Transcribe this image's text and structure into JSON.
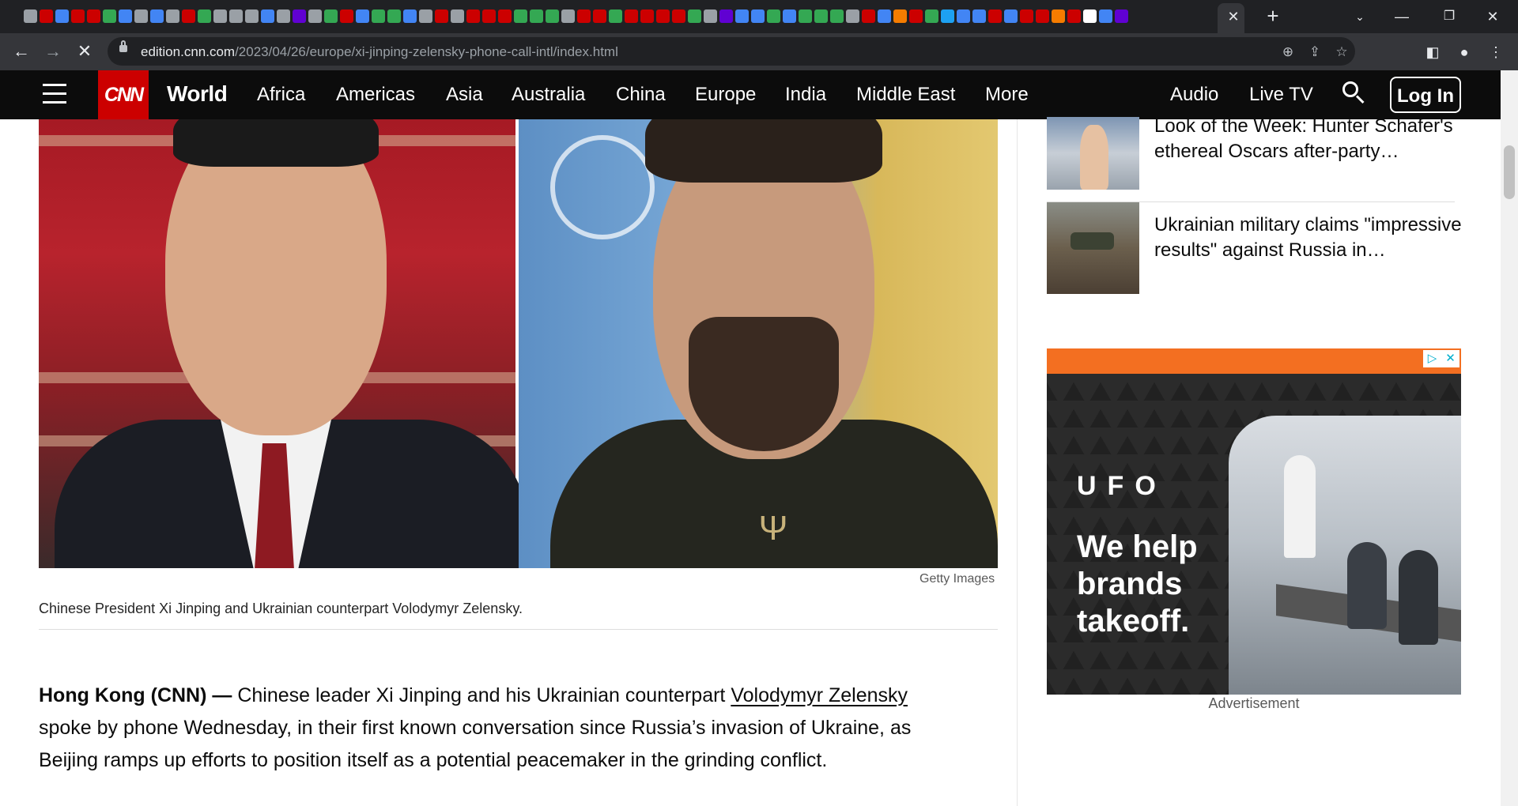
{
  "browser": {
    "url_host": "edition.cnn.com",
    "url_path": "/2023/04/26/europe/xi-jinping-zelensky-phone-call-intl/index.html",
    "tab_colors": [
      "#9aa0a6",
      "#cc0000",
      "#4285f4",
      "#cc0000",
      "#cc0000",
      "#34a853",
      "#4285f4",
      "#9aa0a6",
      "#4285f4",
      "#9aa0a6",
      "#cc0000",
      "#34a853",
      "#9aa0a6",
      "#9aa0a6",
      "#9aa0a6",
      "#4285f4",
      "#9aa0a6",
      "#6001d2",
      "#9aa0a6",
      "#34a853",
      "#cc0000",
      "#4285f4",
      "#34a853",
      "#34a853",
      "#4285f4",
      "#9aa0a6",
      "#cc0000",
      "#9aa0a6",
      "#cc0000",
      "#cc0000",
      "#cc0000",
      "#34a853",
      "#34a853",
      "#34a853",
      "#9aa0a6",
      "#cc0000",
      "#cc0000",
      "#34a853",
      "#cc0000",
      "#cc0000",
      "#cc0000",
      "#cc0000",
      "#34a853",
      "#9aa0a6",
      "#6001d2",
      "#4285f4",
      "#4285f4",
      "#34a853",
      "#4285f4",
      "#34a853",
      "#34a853",
      "#34a853",
      "#9aa0a6",
      "#cc0000",
      "#4285f4",
      "#f57c00",
      "#cc0000",
      "#34a853",
      "#1da1f2",
      "#4285f4",
      "#4285f4",
      "#cc0000",
      "#4285f4",
      "#cc0000",
      "#cc0000",
      "#f57c00",
      "#cc0000",
      "#ffffff",
      "#4285f4",
      "#6001d2"
    ]
  },
  "nav": {
    "logo": "CNN",
    "section": "World",
    "links": [
      "Africa",
      "Americas",
      "Asia",
      "Australia",
      "China",
      "Europe",
      "India",
      "Middle East",
      "More"
    ],
    "audio": "Audio",
    "live_tv": "Live TV",
    "login": "Log In"
  },
  "hero": {
    "credit": "Getty Images",
    "caption": "Chinese President Xi Jinping and Ukrainian counterpart Volodymyr Zelensky."
  },
  "article": {
    "dateline": "Hong Kong (CNN) —",
    "text_before_link": " Chinese leader Xi Jinping and his Ukrainian counterpart ",
    "link": "Volodymyr Zelensky",
    "text_after_link": " spoke by phone Wednesday, in their first known conversation since Russia’s invasion of Ukraine, as Beijing ramps up efforts to position itself as a potential peacemaker in the grinding conflict."
  },
  "related": [
    {
      "title": "Look of the Week: Hunter Schafer's ethereal Oscars after-party…"
    },
    {
      "title": "Ukrainian military claims \"impressive results\" against Russia in…"
    }
  ],
  "ad": {
    "brand": "UFO",
    "tagline": "We help brands takeoff.",
    "label": "Advertisement",
    "choices_icon": "▷",
    "close_icon": "✕"
  }
}
